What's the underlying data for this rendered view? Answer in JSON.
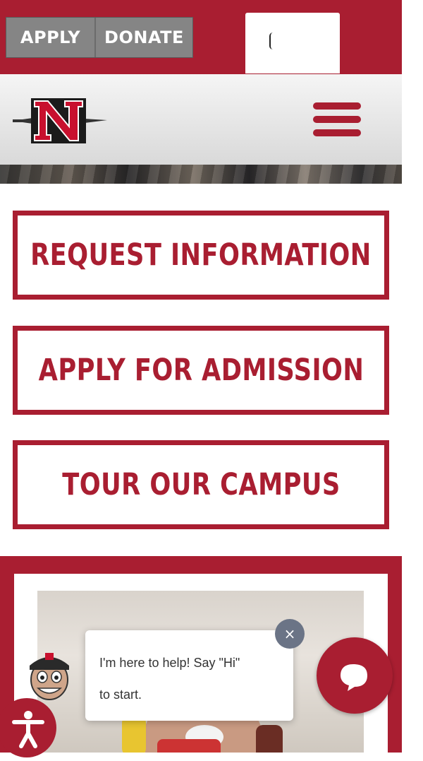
{
  "topbar": {
    "apply_label": "APPLY",
    "donate_label": "DONATE",
    "search_value": ""
  },
  "nav": {
    "logo_alt": "N",
    "menu_icon": "hamburger-menu-icon"
  },
  "cta": {
    "request_info": "REQUEST INFORMATION",
    "apply_admission": "APPLY FOR ADMISSION",
    "tour_campus": "TOUR OUR CAMPUS"
  },
  "chat": {
    "message_line1": "I'm here to help! Say \"Hi\"",
    "message_line2": "to start.",
    "close_glyph": "×"
  },
  "colors": {
    "brand_red": "#a91e31",
    "button_gray": "#858585"
  }
}
